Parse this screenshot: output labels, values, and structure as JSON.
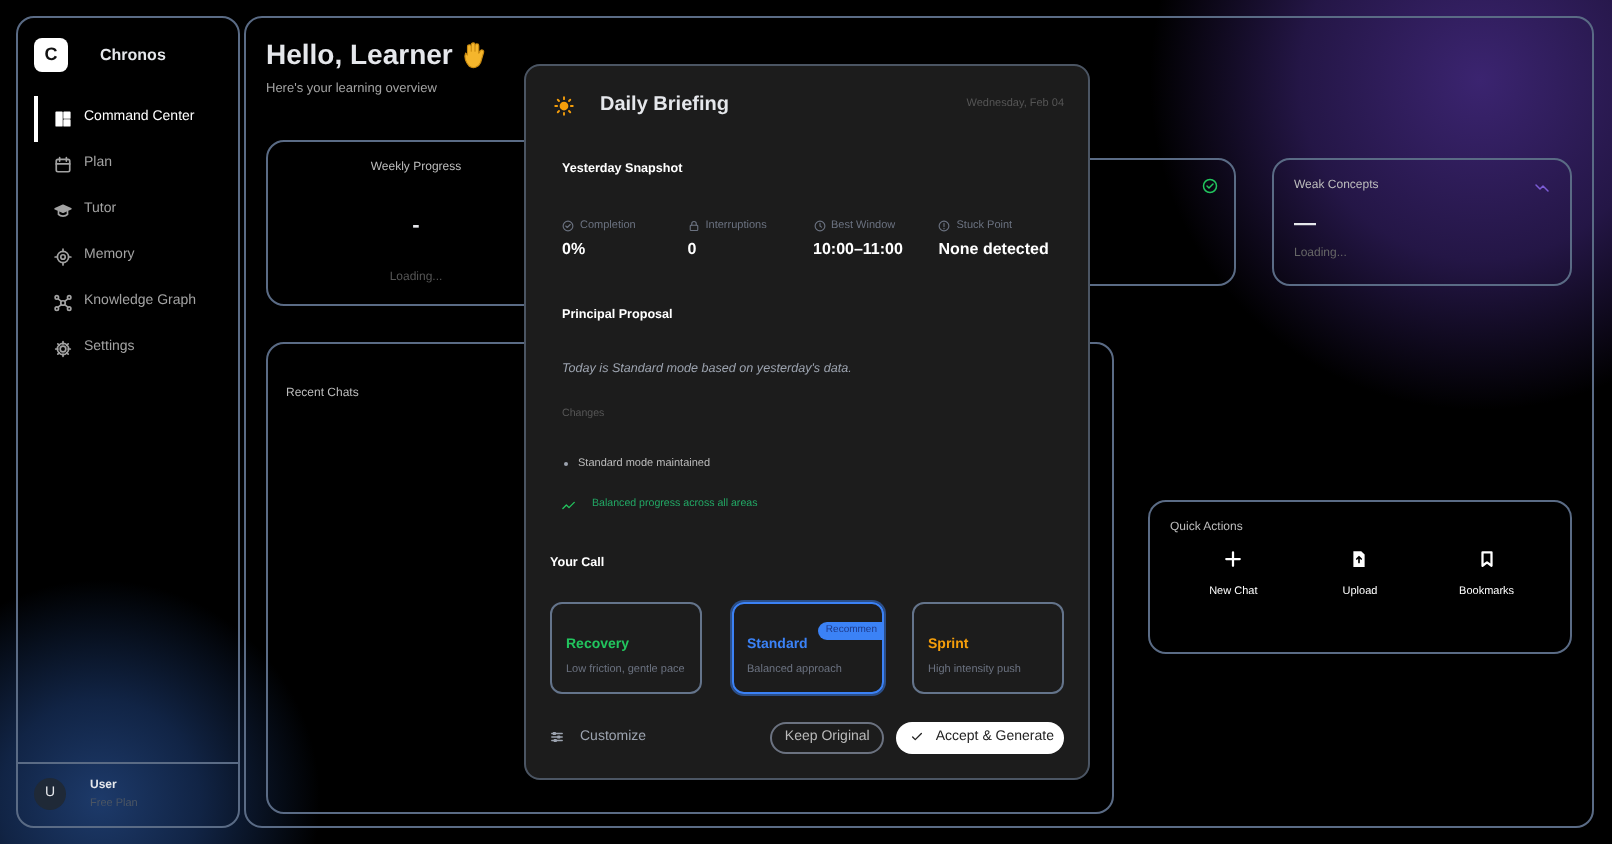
{
  "sidebar": {
    "logo_letter": "C",
    "app_name": "Chronos",
    "items": [
      {
        "label": "Command Center",
        "selected": true
      },
      {
        "label": "Plan",
        "selected": false
      },
      {
        "label": "Tutor",
        "selected": false
      },
      {
        "label": "Memory",
        "selected": false
      },
      {
        "label": "Knowledge Graph",
        "selected": false
      },
      {
        "label": "Settings",
        "selected": false
      }
    ],
    "user": {
      "initial": "U",
      "name": "User",
      "plan": "Free Plan"
    }
  },
  "main": {
    "greeting": "Hello, Learner",
    "subtitle": "Here's your learning overview",
    "weekly_progress": {
      "title": "Weekly Progress",
      "value": "-",
      "status": "Loading..."
    },
    "weak_concepts": {
      "title": "Weak Concepts",
      "value": "—",
      "status": "Loading..."
    },
    "recent_chats": {
      "title": "Recent Chats"
    },
    "quick_actions": {
      "title": "Quick Actions",
      "actions": [
        {
          "label": "New Chat"
        },
        {
          "label": "Upload"
        },
        {
          "label": "Bookmarks"
        }
      ]
    }
  },
  "briefing": {
    "title": "Daily Briefing",
    "date": "Wednesday, Feb 04",
    "snapshot_title": "Yesterday Snapshot",
    "stats": [
      {
        "label": "Completion",
        "value": "0%"
      },
      {
        "label": "Interruptions",
        "value": "0"
      },
      {
        "label": "Best Window",
        "value": "10:00–11:00"
      },
      {
        "label": "Stuck Point",
        "value": "None detected"
      }
    ],
    "proposal_title": "Principal Proposal",
    "proposal": "Today is Standard mode based on yesterday's data.",
    "changes_label": "Changes",
    "changes": [
      "Standard mode maintained"
    ],
    "insight": "Balanced progress across all areas",
    "call_title": "Your Call",
    "options": [
      {
        "name": "Recovery",
        "description": "Low friction, gentle pace",
        "color": "#22c55e",
        "selected": false
      },
      {
        "name": "Standard",
        "description": "Balanced approach",
        "color": "#3b82f6",
        "selected": true,
        "badge": "Recommen"
      },
      {
        "name": "Sprint",
        "description": "High intensity push",
        "color": "#f59e0b",
        "selected": false
      }
    ],
    "customize": "Customize",
    "keep": "Keep Original",
    "accept": "Accept & Generate"
  }
}
